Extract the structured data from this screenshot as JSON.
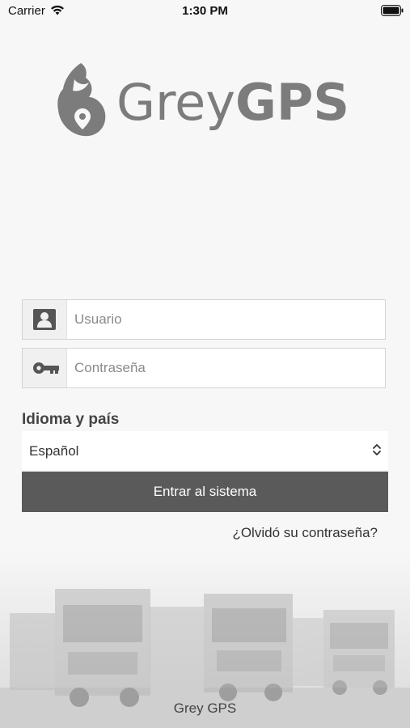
{
  "status_bar": {
    "carrier": "Carrier",
    "time": "1:30 PM"
  },
  "logo": {
    "text_part1": "Grey",
    "text_part2": "GPS"
  },
  "login": {
    "username_placeholder": "Usuario",
    "password_placeholder": "Contraseña",
    "language_label": "Idioma y país",
    "language_value": "Español",
    "submit_label": "Entrar al sistema",
    "forgot_label": "¿Olvidó su contraseña?"
  },
  "footer": {
    "brand": "Grey GPS"
  },
  "colors": {
    "logo": "#7c7c7c",
    "button": "#5a5a5a",
    "background": "#f7f7f7"
  }
}
